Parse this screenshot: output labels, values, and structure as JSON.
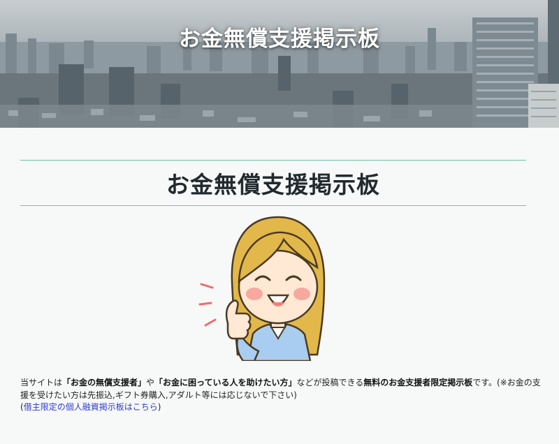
{
  "header": {
    "site_title": "お金無償支援掲示板"
  },
  "main": {
    "page_title": "お金無償支援掲示板",
    "intro": {
      "prefix": "当サイトは",
      "bold_1": "「お金の無償支援者」",
      "conj": "や",
      "bold_2": "「お金に困っている人を助けたい方」",
      "middle": "などが投稿できる",
      "bold_3": "無料のお金支援者限定掲示板",
      "suffix": "です。(※お金の支援を受けたい方は先振込,ギフト券購入,アダルト等には応じないで下さい)",
      "link_open": "(",
      "link_text": "借主限定の個人融資掲示板はこちら",
      "link_close": ")"
    }
  },
  "colors": {
    "accent_line": "#6cc3a6",
    "link": "#2b3bd1",
    "hair": "#e2b84a"
  },
  "icons": {
    "mascot": "thumbs-up-woman-illustration"
  }
}
